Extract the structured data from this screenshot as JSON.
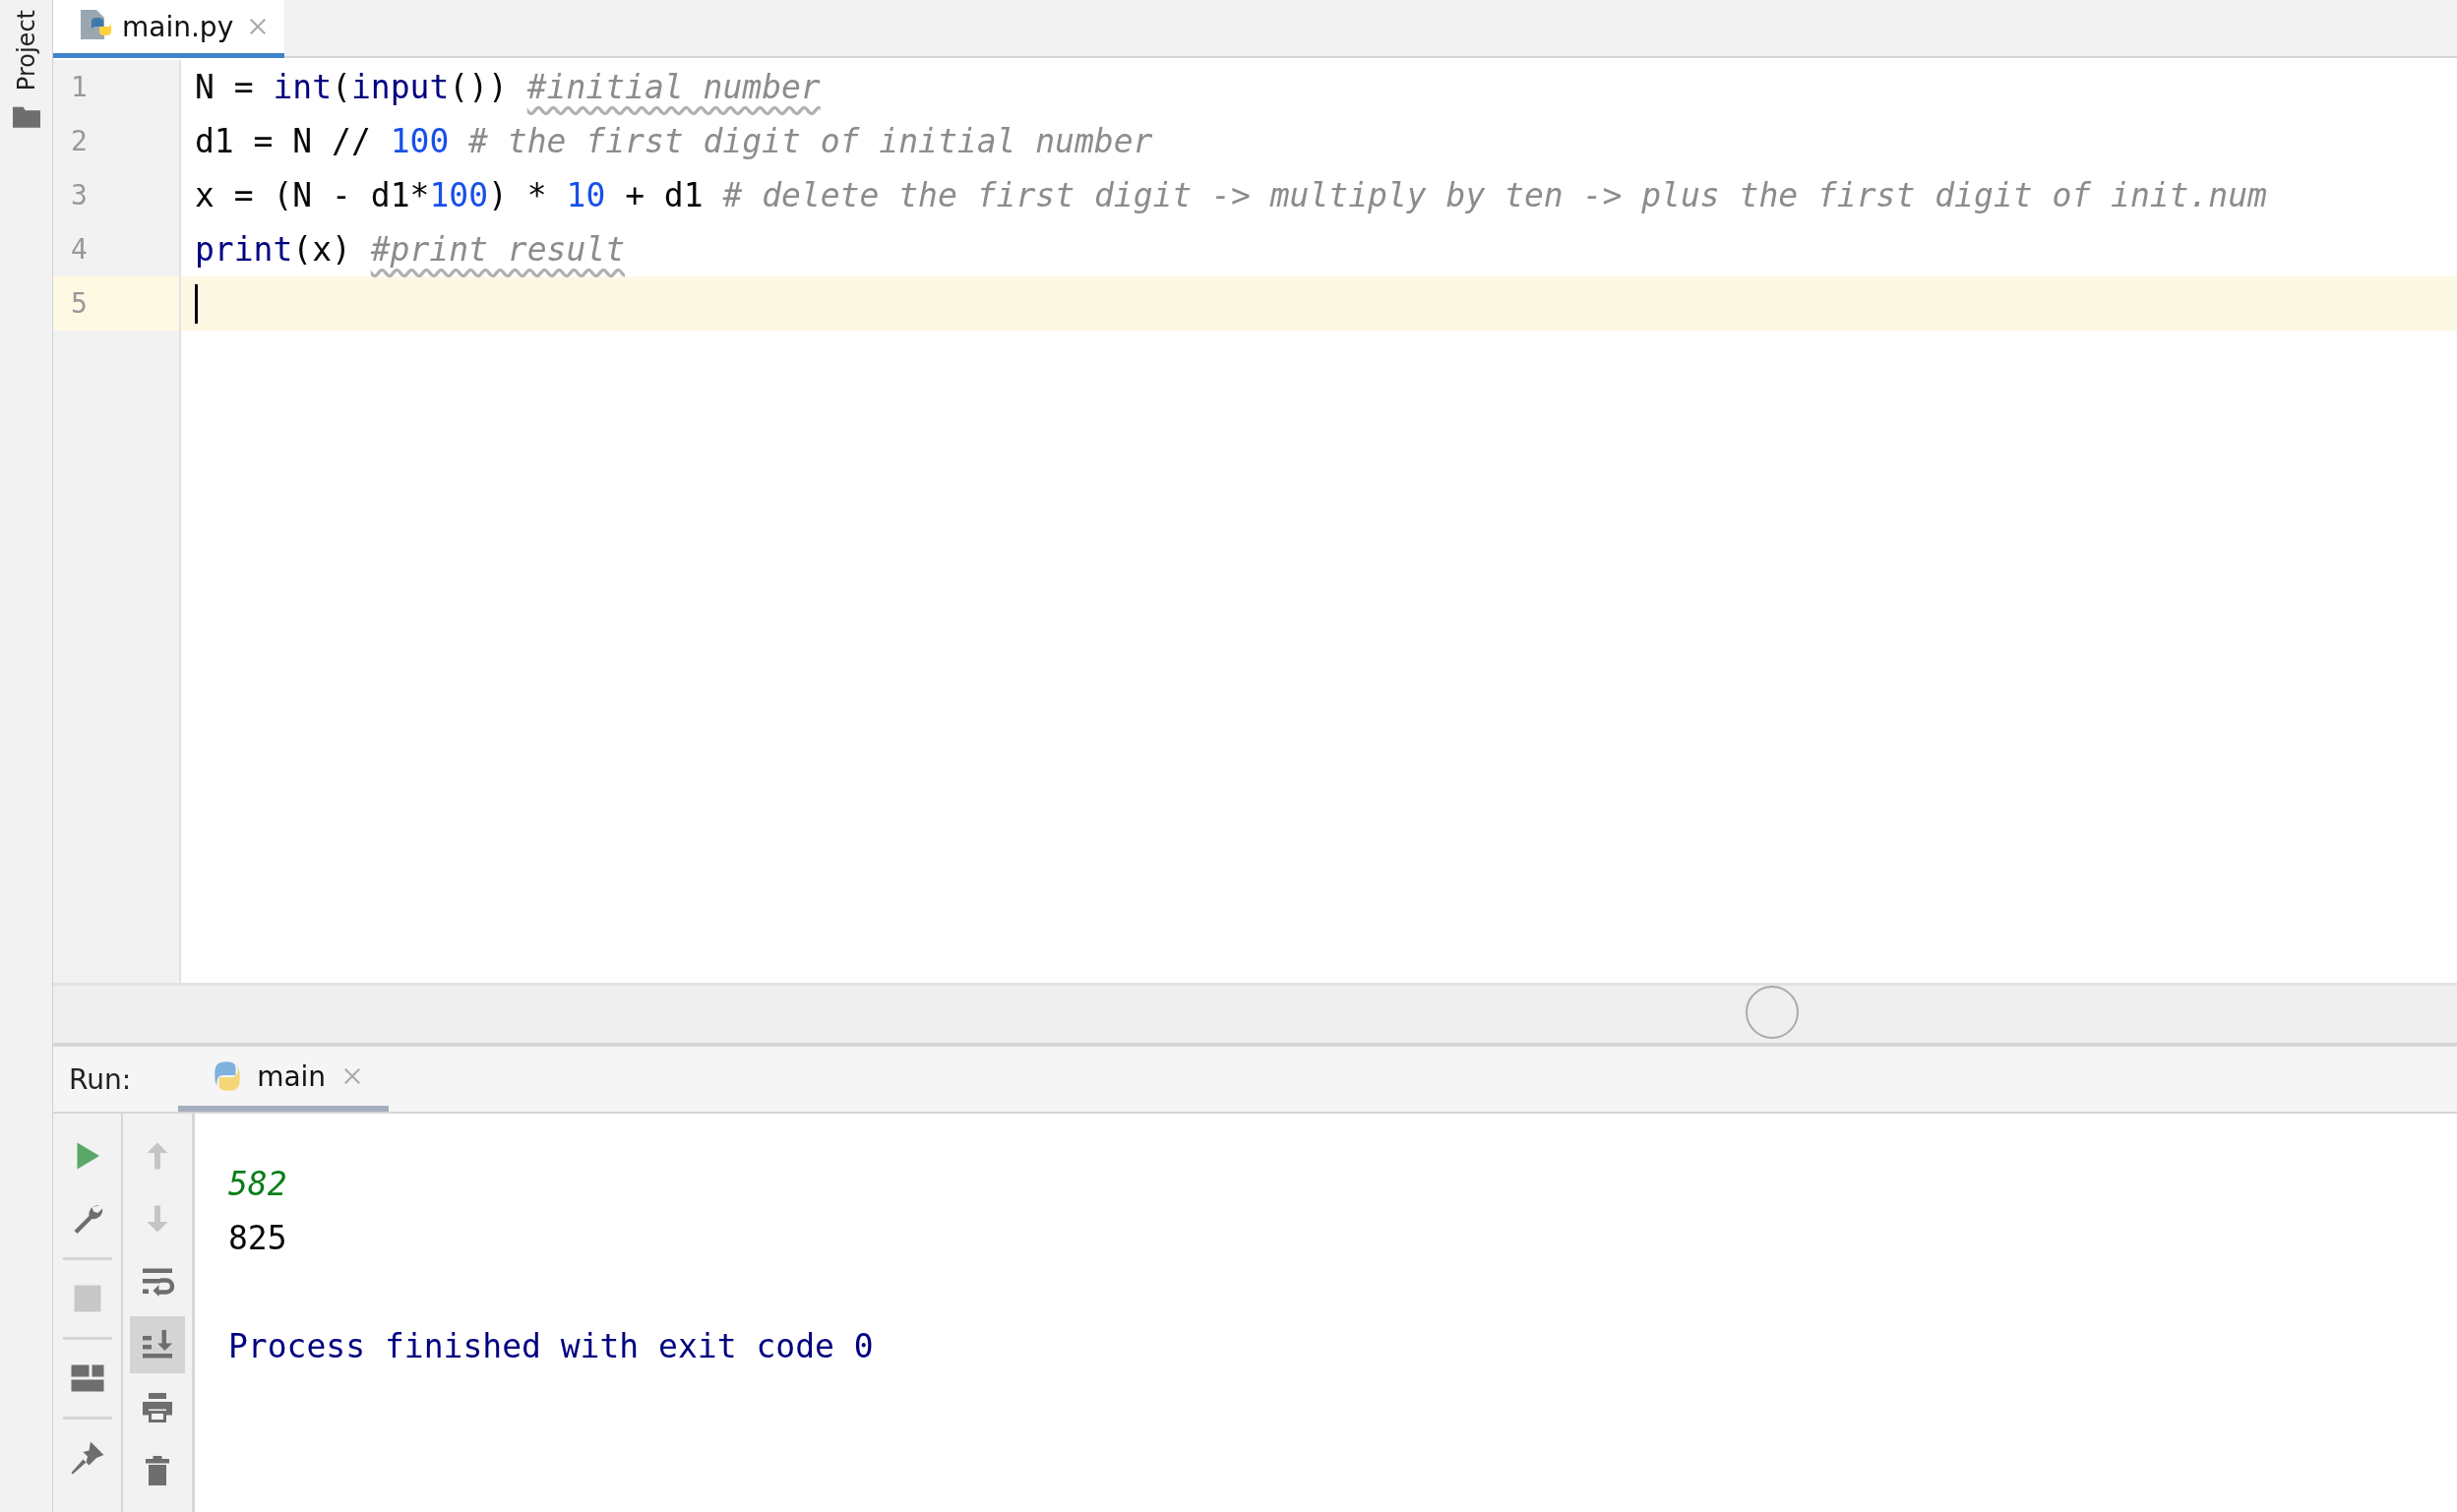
{
  "sidebar": {
    "label": "Project"
  },
  "editor_tabs": [
    {
      "label": "main.py",
      "selected": true
    }
  ],
  "code_lines": [
    {
      "number": "1",
      "current": false,
      "tokens": [
        {
          "kind": "plain",
          "text": "N = "
        },
        {
          "kind": "builtin",
          "text": "int"
        },
        {
          "kind": "plain",
          "text": "("
        },
        {
          "kind": "builtin",
          "text": "input"
        },
        {
          "kind": "plain",
          "text": "())"
        },
        {
          "kind": "comment",
          "text": "#initial number",
          "flagged": true
        }
      ]
    },
    {
      "number": "2",
      "current": false,
      "tokens": [
        {
          "kind": "plain",
          "text": "d1 = N // "
        },
        {
          "kind": "number",
          "text": "100"
        },
        {
          "kind": "comment",
          "text": "# the first digit of initial number",
          "flagged": false
        }
      ]
    },
    {
      "number": "3",
      "current": false,
      "tokens": [
        {
          "kind": "plain",
          "text": "x = (N - d1*"
        },
        {
          "kind": "number",
          "text": "100"
        },
        {
          "kind": "plain",
          "text": ") * "
        },
        {
          "kind": "number",
          "text": "10"
        },
        {
          "kind": "plain",
          "text": " + d1"
        },
        {
          "kind": "comment",
          "text": "# delete the first digit -> multiply by ten -> plus the first digit of init.num",
          "flagged": false
        }
      ]
    },
    {
      "number": "4",
      "current": false,
      "tokens": [
        {
          "kind": "builtin",
          "text": "print"
        },
        {
          "kind": "plain",
          "text": "(x)"
        },
        {
          "kind": "comment",
          "text": "#print result",
          "flagged": true
        }
      ]
    },
    {
      "number": "5",
      "current": true
    }
  ],
  "run_panel": {
    "label": "Run:",
    "tabs": [
      {
        "label": "main",
        "selected": true
      }
    ],
    "left_tools": [
      {
        "kind": "run",
        "disabled": false
      },
      {
        "kind": "settings",
        "disabled": false
      },
      {
        "kind": "separator"
      },
      {
        "kind": "stop",
        "disabled": true
      },
      {
        "kind": "separator"
      },
      {
        "kind": "layout",
        "disabled": false
      },
      {
        "kind": "separator"
      },
      {
        "kind": "pin",
        "disabled": false
      }
    ],
    "right_tools": [
      {
        "kind": "up",
        "disabled": true,
        "on": false
      },
      {
        "kind": "down",
        "disabled": true,
        "on": false
      },
      {
        "kind": "wrap",
        "disabled": false,
        "on": false
      },
      {
        "kind": "scroll-end",
        "disabled": false,
        "on": true
      },
      {
        "kind": "print",
        "disabled": false,
        "on": false
      },
      {
        "kind": "trash",
        "disabled": false,
        "on": false
      }
    ],
    "output": [
      {
        "kind": "input",
        "text": "582"
      },
      {
        "kind": "output",
        "text": "825"
      },
      {
        "kind": "system",
        "text": "Process finished with exit code 0"
      }
    ]
  }
}
